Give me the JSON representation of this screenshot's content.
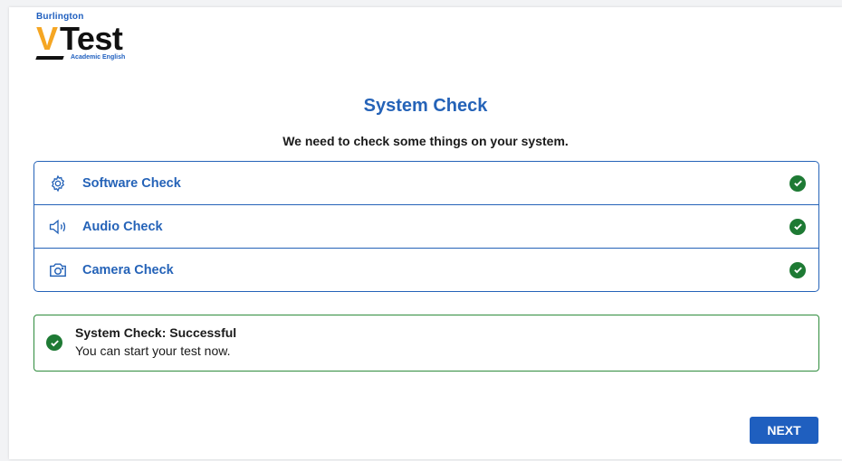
{
  "logo": {
    "brand": "Burlington",
    "v": "V",
    "test": "Test",
    "subtitle": "Academic English"
  },
  "page": {
    "title": "System Check",
    "subtitle": "We need to check some things on your system."
  },
  "checks": [
    {
      "label": "Software Check",
      "icon": "gear-icon",
      "status": "passed"
    },
    {
      "label": "Audio Check",
      "icon": "speaker-icon",
      "status": "passed"
    },
    {
      "label": "Camera Check",
      "icon": "camera-icon",
      "status": "passed"
    }
  ],
  "result": {
    "title": "System Check: Successful",
    "message": "You can start your test now."
  },
  "next_label": "NEXT",
  "colors": {
    "accent": "#2563b8",
    "success": "#1e7a34",
    "logo_orange": "#f5a623",
    "button": "#1f5fbf"
  }
}
